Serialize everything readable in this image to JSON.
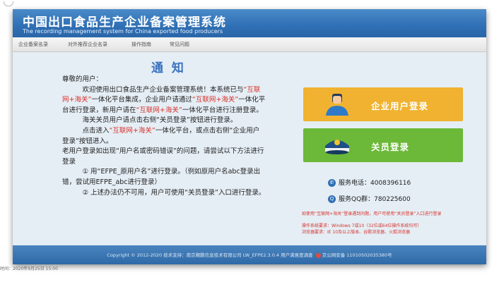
{
  "header": {
    "title_cn": "中国出口食品生产企业备案管理系统",
    "title_en": "The recording management system for China exported food producers"
  },
  "nav": [
    "企业备案名录",
    "对外推荐企业名录",
    "操作指南",
    "常见问题"
  ],
  "notice": {
    "title": "通 知",
    "greeting": "尊敬的用户：",
    "p1_a": "欢迎使用出口食品生产企业备案管理系统！本系统已与",
    "p1_red1": "“互联网+海关”",
    "p1_b": "一体化平台集成，企业用户请通过",
    "p1_red2": "“互联网+海关”",
    "p1_c": "一体化平台进行登录，新用户请在",
    "p1_red3": "“互联网+海关”",
    "p1_d": "一体化平台进行注册登录。",
    "p2": "海关关员用户请点击右侧“关员登录”按钮进行登录。",
    "p3_a": "点击进入",
    "p3_red": "“互联网+海关”",
    "p3_b": "一体化平台，或点击右侧“企业用户登录”按钮进入。",
    "p4": "老用户登录如出现“用户名或密码错误”的问题，请尝试以下方法进行登录",
    "p5": "① 用“EFPE_原用户名”进行登录。（例如原用户名abc登录出错，尝试用EFPE_abc进行登录）",
    "p6": "② 上述办法仍不可用，用户可使用“关员登录”入口进行登录。"
  },
  "buttons": {
    "enterprise_login": "企业用户登录",
    "officer_login": "关员登录"
  },
  "contact": {
    "phone": "服务电话：4008396116",
    "qq": "服务QQ群：780225600"
  },
  "notes": {
    "note1": "如使用“互联网+海关”登录遇到问题，用户可使用“关员登录”入口进行登录",
    "note2": "操作系统要求：Windows 7或10（32位或64位操作系统均可）",
    "note3": "浏览器要求：IE 10及以上版本、谷歌浏览器、火狐浏览器"
  },
  "footer": {
    "text_a": "Copyright © 2012-2020 技术支持：南京飓鹏信息技术有限公司 LW_EFPE2.3.0.4 用户满意度调查",
    "text_b": "京公网安备 11010502035380号"
  },
  "outside_text": "时间：2020年9月25日 15:00",
  "colors": {
    "header_blue": "#2f6fb4",
    "enterprise_btn": "#f0b230",
    "officer_btn": "#6cb838",
    "alert_red": "#d8312a"
  }
}
